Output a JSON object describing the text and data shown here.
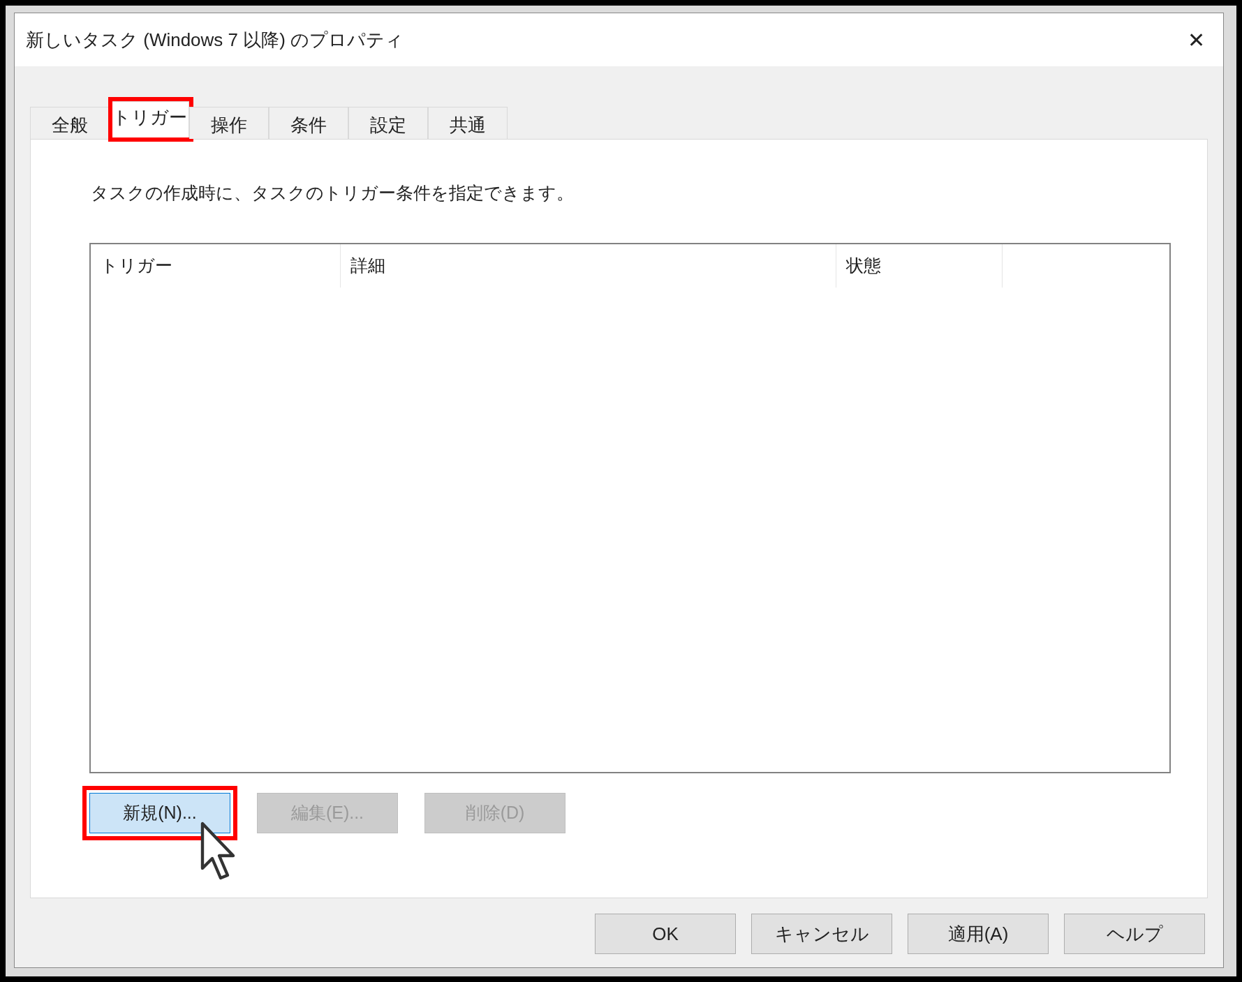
{
  "window": {
    "title": "新しいタスク (Windows 7 以降) のプロパティ",
    "close": "✕"
  },
  "tabs": [
    {
      "label": "全般",
      "selected": false,
      "highlighted": false
    },
    {
      "label": "トリガー",
      "selected": true,
      "highlighted": true
    },
    {
      "label": "操作",
      "selected": false,
      "highlighted": false
    },
    {
      "label": "条件",
      "selected": false,
      "highlighted": false
    },
    {
      "label": "設定",
      "selected": false,
      "highlighted": false
    },
    {
      "label": "共通",
      "selected": false,
      "highlighted": false
    }
  ],
  "description": "タスクの作成時に、タスクのトリガー条件を指定できます。",
  "table": {
    "columns": [
      "トリガー",
      "詳細",
      "状態"
    ]
  },
  "list_buttons": [
    {
      "label": "新規(N)...",
      "disabled": false,
      "hovered": true,
      "highlighted": true
    },
    {
      "label": "編集(E)...",
      "disabled": true,
      "hovered": false,
      "highlighted": false
    },
    {
      "label": "削除(D)",
      "disabled": true,
      "hovered": false,
      "highlighted": false
    }
  ],
  "dialog_buttons": [
    "OK",
    "キャンセル",
    "適用(A)",
    "ヘルプ"
  ]
}
